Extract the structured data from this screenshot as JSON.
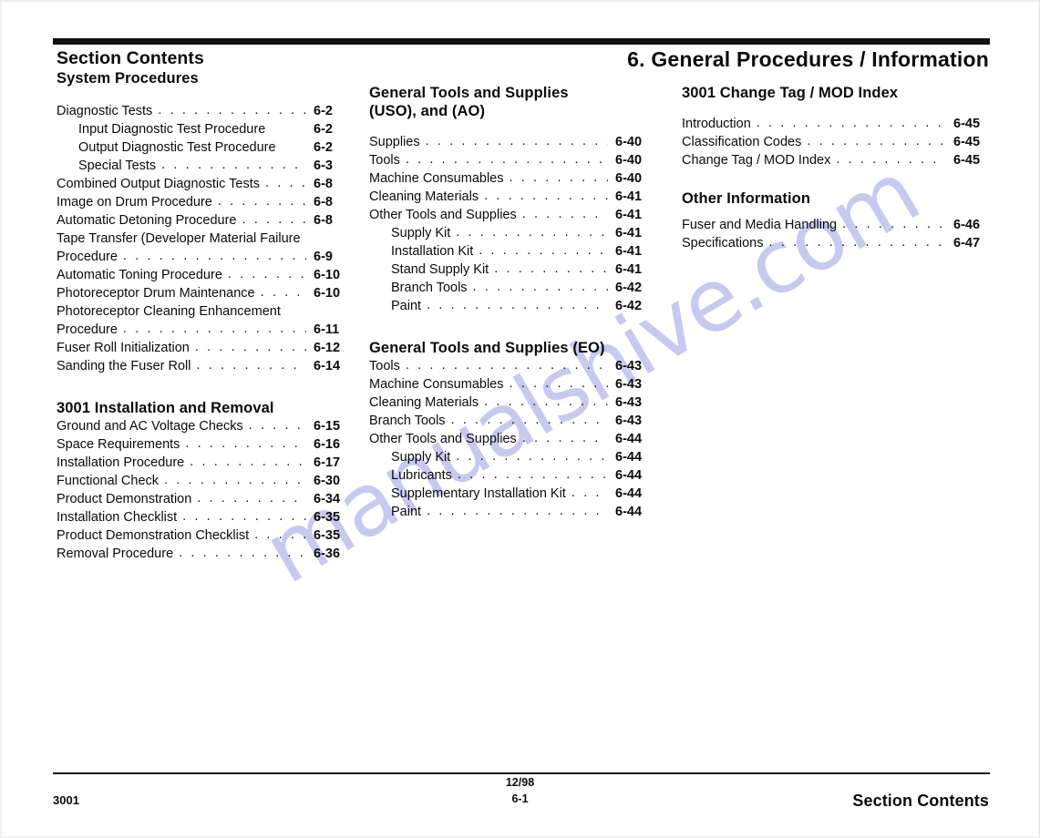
{
  "header": {
    "title_line1": "Section Contents",
    "title_line2": "System Procedures",
    "chapter_title": "6.  General Procedures / Information"
  },
  "watermark": {
    "text": "manualshive.com",
    "color": "#c3c6ee"
  },
  "columns": {
    "col1": {
      "entries": [
        {
          "label": "Diagnostic Tests",
          "page": "6-2",
          "level": 0,
          "dots": true
        },
        {
          "label": "Input Diagnostic Test Procedure",
          "page": "6-2",
          "level": 1,
          "dots": false
        },
        {
          "label": "Output Diagnostic Test Procedure",
          "page": "6-2",
          "level": 1,
          "dots": false
        },
        {
          "label": "Special Tests",
          "page": "6-3",
          "level": 1,
          "dots": true
        },
        {
          "label": "Combined Output  Diagnostic Tests",
          "page": "6-8",
          "level": 0,
          "dots": true
        },
        {
          "label": "Image on Drum Procedure",
          "page": "6-8",
          "level": 0,
          "dots": true
        },
        {
          "label": " Automatic Detoning Procedure",
          "page": "6-8",
          "level": 0,
          "dots": true
        },
        {
          "label": "Tape Transfer (Developer Material Failure",
          "page": "",
          "level": 0,
          "dots": false,
          "wrap_head": true
        },
        {
          "label": "Procedure",
          "page": "6-9",
          "level": 0,
          "dots": true
        },
        {
          "label": "Automatic Toning Procedure",
          "page": "6-10",
          "level": 0,
          "dots": true
        },
        {
          "label": "Photoreceptor Drum Maintenance",
          "page": "6-10",
          "level": 0,
          "dots": true
        },
        {
          "label": "Photoreceptor Cleaning Enhancement",
          "page": "",
          "level": 0,
          "dots": false,
          "wrap_head": true
        },
        {
          "label": "Procedure",
          "page": "6-11",
          "level": 0,
          "dots": true
        },
        {
          "label": "Fuser Roll Initialization",
          "page": "6-12",
          "level": 0,
          "dots": true
        },
        {
          "label": "Sanding the Fuser Roll",
          "page": "6-14",
          "level": 0,
          "dots": true
        }
      ],
      "section2_heading": "3001  Installation and Removal",
      "section2_entries": [
        {
          "label": "Ground and AC Voltage Checks",
          "page": "6-15",
          "level": 0,
          "dots": true
        },
        {
          "label": "Space Requirements",
          "page": "6-16",
          "level": 0,
          "dots": true
        },
        {
          "label": "Installation Procedure",
          "page": "6-17",
          "level": 0,
          "dots": true
        },
        {
          "label": "Functional Check",
          "page": "6-30",
          "level": 0,
          "dots": true
        },
        {
          "label": "Product Demonstration",
          "page": "6-34",
          "level": 0,
          "dots": true
        },
        {
          "label": "Installation Checklist",
          "page": "6-35",
          "level": 0,
          "dots": true
        },
        {
          "label": "Product Demonstration Checklist",
          "page": "6-35",
          "level": 0,
          "dots": true
        },
        {
          "label": "Removal Procedure",
          "page": "6-36",
          "level": 0,
          "dots": true
        }
      ]
    },
    "col2": {
      "heading_line1": "General Tools and Supplies",
      "heading_line2": "(USO), and (AO)",
      "entries": [
        {
          "label": "Supplies",
          "page": "6-40",
          "level": 0,
          "dots": true
        },
        {
          "label": "Tools",
          "page": "6-40",
          "level": 0,
          "dots": true
        },
        {
          "label": "Machine Consumables",
          "page": "6-40",
          "level": 0,
          "dots": true
        },
        {
          "label": "Cleaning Materials",
          "page": "6-41",
          "level": 0,
          "dots": true
        },
        {
          "label": "Other Tools and Supplies",
          "page": "6-41",
          "level": 0,
          "dots": true
        },
        {
          "label": "Supply Kit",
          "page": "6-41",
          "level": 1,
          "dots": true
        },
        {
          "label": "Installation Kit",
          "page": "6-41",
          "level": 1,
          "dots": true
        },
        {
          "label": "Stand Supply Kit",
          "page": "6-41",
          "level": 1,
          "dots": true
        },
        {
          "label": "Branch Tools",
          "page": "6-42",
          "level": 1,
          "dots": true
        },
        {
          "label": "Paint",
          "page": "6-42",
          "level": 1,
          "dots": true
        }
      ],
      "heading2": "General Tools and Supplies (EO)",
      "entries2": [
        {
          "label": "Tools",
          "page": "6-43",
          "level": 0,
          "dots": true
        },
        {
          "label": "Machine Consumables",
          "page": "6-43",
          "level": 0,
          "dots": true
        },
        {
          "label": "Cleaning Materials",
          "page": "6-43",
          "level": 0,
          "dots": true
        },
        {
          "label": "Branch Tools",
          "page": "6-43",
          "level": 0,
          "dots": true
        },
        {
          "label": "Other Tools and Supplies",
          "page": "6-44",
          "level": 0,
          "dots": true
        },
        {
          "label": "Supply Kit",
          "page": "6-44",
          "level": 1,
          "dots": true
        },
        {
          "label": "Lubricants",
          "page": "6-44",
          "level": 1,
          "dots": true
        },
        {
          "label": "Supplementary Installation Kit",
          "page": "6-44",
          "level": 1,
          "dots": true
        },
        {
          "label": "Paint",
          "page": "6-44",
          "level": 1,
          "dots": true
        }
      ]
    },
    "col3": {
      "heading": "3001 Change Tag / MOD Index",
      "entries": [
        {
          "label": "Introduction",
          "page": "6-45",
          "level": 0,
          "dots": true
        },
        {
          "label": "Classification Codes",
          "page": "6-45",
          "level": 0,
          "dots": true
        },
        {
          "label": "Change Tag  / MOD Index",
          "page": "6-45",
          "level": 0,
          "dots": true
        }
      ],
      "heading2": "Other Information",
      "entries2": [
        {
          "label": "Fuser and Media Handling",
          "page": "6-46",
          "level": 0,
          "dots": true
        },
        {
          "label": "Specifications",
          "page": "6-47",
          "level": 0,
          "dots": true
        }
      ]
    }
  },
  "footer": {
    "left": "3001",
    "date": "12/98",
    "page": "6-1",
    "right": "Section Contents"
  }
}
